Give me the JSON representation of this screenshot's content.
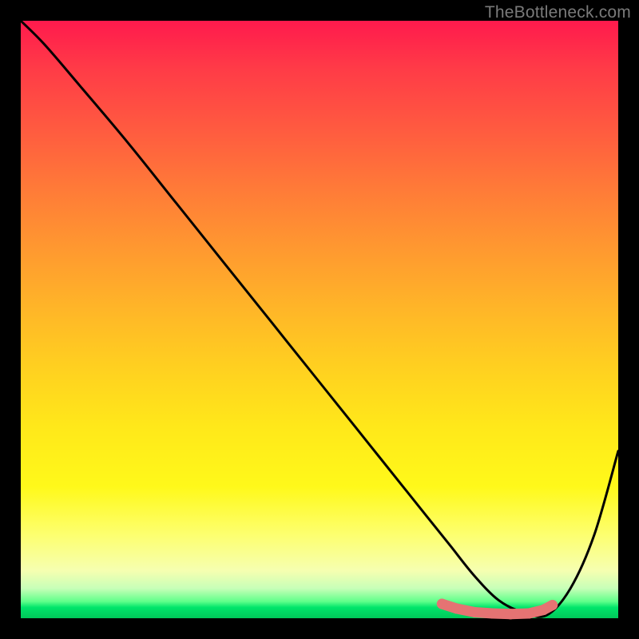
{
  "watermark": "TheBottleneck.com",
  "colors": {
    "frame": "#000000",
    "curve": "#000000",
    "marker_fill": "#e57373",
    "marker_stroke": "#c94f4f"
  },
  "chart_data": {
    "type": "line",
    "title": "",
    "xlabel": "",
    "ylabel": "",
    "xlim": [
      0,
      100
    ],
    "ylim": [
      0,
      100
    ],
    "grid": false,
    "legend": false,
    "series": [
      {
        "name": "bottleneck-curve",
        "x": [
          0,
          4,
          10,
          18,
          26,
          34,
          42,
          50,
          56,
          60,
          64,
          68,
          72,
          76,
          80,
          84,
          88,
          92,
          96,
          100
        ],
        "y": [
          100,
          96,
          89,
          79.5,
          69.5,
          59.5,
          49.5,
          39.5,
          32,
          27,
          22,
          17,
          12,
          7,
          3,
          1,
          0.5,
          5,
          14,
          28
        ]
      }
    ],
    "markers": {
      "name": "highlight-band",
      "x_range": [
        70,
        89
      ],
      "points": [
        {
          "x": 70.5,
          "y": 2.4
        },
        {
          "x": 73,
          "y": 1.6
        },
        {
          "x": 76,
          "y": 1.0
        },
        {
          "x": 79,
          "y": 0.8
        },
        {
          "x": 82,
          "y": 0.7
        },
        {
          "x": 85,
          "y": 0.8
        },
        {
          "x": 87.5,
          "y": 1.4
        },
        {
          "x": 89,
          "y": 2.2
        }
      ]
    }
  }
}
